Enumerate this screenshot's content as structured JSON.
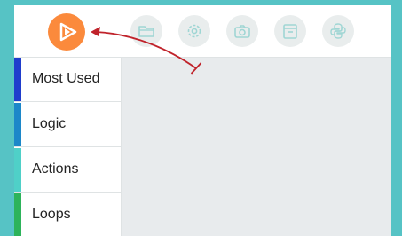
{
  "logo": {
    "icon": "play-logo-icon",
    "color": "#fb8a3c"
  },
  "toolbar": {
    "buttons": [
      {
        "icon": "folder-icon"
      },
      {
        "icon": "gear-icon"
      },
      {
        "icon": "camera-icon"
      },
      {
        "icon": "archive-icon"
      },
      {
        "icon": "python-icon"
      }
    ]
  },
  "sidebar": {
    "categories": [
      {
        "label": "Most Used",
        "color": "#1f3dcc"
      },
      {
        "label": "Logic",
        "color": "#1c87c9"
      },
      {
        "label": "Actions",
        "color": "#4fd0c8"
      },
      {
        "label": "Loops",
        "color": "#2db35a"
      }
    ]
  },
  "annotation": {
    "icon": "arrow-pointer-icon",
    "color": "#c0232b"
  }
}
